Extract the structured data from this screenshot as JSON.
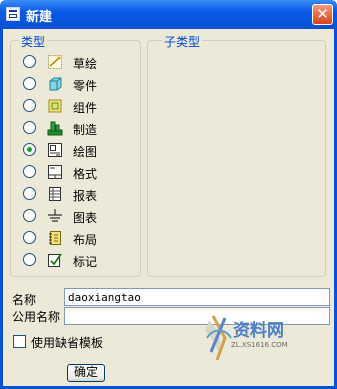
{
  "window": {
    "title": "新建",
    "close_glyph": "✕"
  },
  "type_group": {
    "label": "类型",
    "items": [
      {
        "label": "草绘",
        "icon": "sketch-icon",
        "selected": false
      },
      {
        "label": "零件",
        "icon": "part-icon",
        "selected": false
      },
      {
        "label": "组件",
        "icon": "assembly-icon",
        "selected": false
      },
      {
        "label": "制造",
        "icon": "manufacturing-icon",
        "selected": false
      },
      {
        "label": "绘图",
        "icon": "drawing-icon",
        "selected": true
      },
      {
        "label": "格式",
        "icon": "format-icon",
        "selected": false
      },
      {
        "label": "报表",
        "icon": "report-icon",
        "selected": false
      },
      {
        "label": "图表",
        "icon": "diagram-icon",
        "selected": false
      },
      {
        "label": "布局",
        "icon": "layout-icon",
        "selected": false
      },
      {
        "label": "标记",
        "icon": "markup-icon",
        "selected": false
      }
    ]
  },
  "subtype_group": {
    "label": "子类型"
  },
  "name_field": {
    "label": "名称",
    "value": "daoxiangtao"
  },
  "common_name_field": {
    "label": "公用名称",
    "value": ""
  },
  "default_template": {
    "label": "使用缺省模板",
    "checked": false
  },
  "ok_button": {
    "label": "确定"
  },
  "watermark": {
    "brand": "资料网",
    "url": "ZL.XS1616.COM"
  },
  "colors": {
    "title_bar": "#0a5ae6",
    "dialog_bg": "#ece9d8",
    "group_label": "#0046d5",
    "radio_dot": "#21a121",
    "close_button": "#d9421b"
  }
}
